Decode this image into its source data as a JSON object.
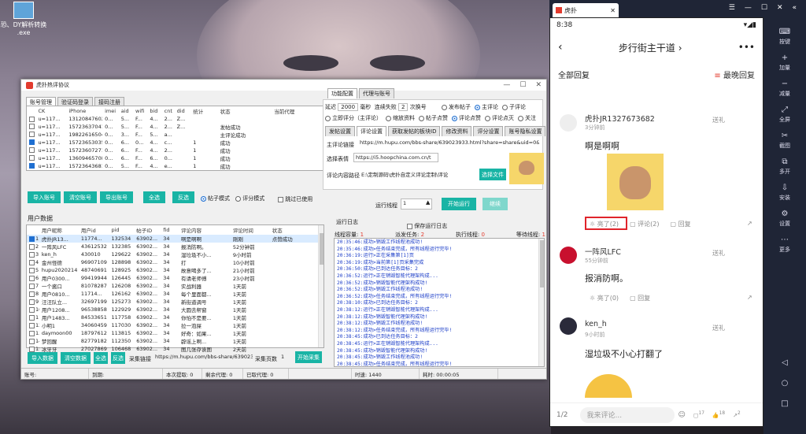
{
  "desktop": {
    "icon_label": "恐、DY解析转换\n.exe"
  },
  "window": {
    "title": "虎扑热评协议"
  },
  "left_tabs": [
    "账号管理",
    "验证码登录",
    "接码注册"
  ],
  "account_headers": [
    "",
    "CK",
    "iPhone",
    "imei",
    "aid",
    "wifi",
    "bid",
    "cnt",
    "did",
    "统计",
    "状态",
    "当前代理"
  ],
  "accounts": [
    {
      "n": "1",
      "ck": "u=117...",
      "phone": "13120847602",
      "imei": "0...",
      "aid": "5...",
      "wifi": "F...",
      "bid": "4...",
      "cnt": "2...",
      "did": "Z...",
      "stat": "",
      "status": "",
      "proxy": "",
      "checked": false
    },
    {
      "n": "2",
      "ck": "u=117...",
      "phone": "15723637041",
      "imei": "0...",
      "aid": "5...",
      "wifi": "F...",
      "bid": "4...",
      "cnt": "2...",
      "did": "Z...",
      "stat": "",
      "status": "发帖成功",
      "proxy": "",
      "checked": false
    },
    {
      "n": "3",
      "ck": "u=117...",
      "phone": "19822616504",
      "imei": "0...",
      "aid": "3...",
      "wifi": "F...",
      "bid": "5...",
      "cnt": "a...",
      "did": "",
      "stat": "",
      "status": "主评论成功",
      "proxy": "",
      "checked": false
    },
    {
      "n": "4",
      "ck": "u=117...",
      "phone": "15723653035",
      "imei": "0...",
      "aid": "6...",
      "wifi": "0...",
      "bid": "4...",
      "cnt": "c...",
      "did": "",
      "stat": "1",
      "status": "成功",
      "proxy": "",
      "checked": true
    },
    {
      "n": "5",
      "ck": "u=117...",
      "phone": "15723607271",
      "imei": "0...",
      "aid": "6...",
      "wifi": "F...",
      "bid": "4...",
      "cnt": "2...",
      "did": "",
      "stat": "1",
      "status": "成功",
      "proxy": "",
      "checked": false
    },
    {
      "n": "6",
      "ck": "u=117...",
      "phone": "13609465708",
      "imei": "0...",
      "aid": "6...",
      "wifi": "F...",
      "bid": "6...",
      "cnt": "0...",
      "did": "",
      "stat": "1",
      "status": "成功",
      "proxy": "",
      "checked": false
    },
    {
      "n": "7",
      "ck": "u=117...",
      "phone": "15723643681",
      "imei": "0...",
      "aid": "5...",
      "wifi": "F...",
      "bid": "4...",
      "cnt": "e...",
      "did": "",
      "stat": "1",
      "status": "成功",
      "proxy": "",
      "checked": true
    }
  ],
  "account_buttons": {
    "import": "导入账号",
    "clear": "清空账号",
    "export": "导出账号",
    "select_all": "全选",
    "invert": "反选"
  },
  "mode": {
    "post": "帖子模式",
    "comment": "评分模式",
    "skip": "跳过已使用"
  },
  "users_label": "用户数据",
  "user_headers": [
    "",
    "用户昵称",
    "用户id",
    "pid",
    "帖子ID",
    "fid",
    "评论内容",
    "评论时间",
    "状态"
  ],
  "users": [
    {
      "n": "1",
      "nick": "虎扑JR13...",
      "uid": "11774...",
      "pid": "132534",
      "tid": "63902...",
      "fid": "34",
      "content": "啊是啊啊",
      "time": "刚刚",
      "status": "点赞成功",
      "checked": true
    },
    {
      "n": "2",
      "nick": "一阵风LFC",
      "uid": "43612532",
      "pid": "132385",
      "tid": "63902...",
      "fid": "34",
      "content": "报消防啊。",
      "time": "52分钟前",
      "status": "",
      "checked": false
    },
    {
      "n": "3",
      "nick": "ken_h",
      "uid": "430010",
      "pid": "129622",
      "tid": "63902...",
      "fid": "34",
      "content": "湿垃圾不小...",
      "time": "9小时前",
      "status": "",
      "checked": false
    },
    {
      "n": "4",
      "nick": "金州怪德",
      "uid": "96907109",
      "pid": "128898",
      "tid": "63902...",
      "fid": "34",
      "content": "打",
      "time": "10小时前",
      "status": "",
      "checked": false
    },
    {
      "n": "5",
      "nick": "hupu2020214",
      "uid": "48740691",
      "pid": "128925",
      "tid": "63902...",
      "fid": "34",
      "content": "故意喝多了...",
      "time": "21小时前",
      "status": "",
      "checked": false
    },
    {
      "n": "6",
      "nick": "用户0300...",
      "uid": "99419944",
      "pid": "126445",
      "tid": "63902...",
      "fid": "34",
      "content": "有请老师傅",
      "time": "23小时前",
      "status": "",
      "checked": false
    },
    {
      "n": "7",
      "nick": "一个酱口",
      "uid": "81078287",
      "pid": "126208",
      "tid": "63902...",
      "fid": "34",
      "content": "实战利器",
      "time": "1天前",
      "status": "",
      "checked": false
    },
    {
      "n": "8",
      "nick": "用户0810...",
      "uid": "11714...",
      "pid": "126162",
      "tid": "63902...",
      "fid": "34",
      "content": "每个里面都...",
      "time": "1天前",
      "status": "",
      "checked": false
    },
    {
      "n": "9",
      "nick": "汪汪队立...",
      "uid": "32697199",
      "pid": "125273",
      "tid": "63902...",
      "fid": "34",
      "content": "新街道调号",
      "time": "1天前",
      "status": "",
      "checked": false
    },
    {
      "n": "10",
      "nick": "用户1208...",
      "uid": "96538858",
      "pid": "122929",
      "tid": "63902...",
      "fid": "34",
      "content": "大圆去帮窗",
      "time": "1天前",
      "status": "",
      "checked": false
    },
    {
      "n": "11",
      "nick": "用户1483...",
      "uid": "84533651",
      "pid": "117758",
      "tid": "63902...",
      "fid": "34",
      "content": "你怕不是要...",
      "time": "1天前",
      "status": "",
      "checked": false
    },
    {
      "n": "12",
      "nick": "小明1",
      "uid": "34060459",
      "pid": "117030",
      "tid": "63902...",
      "fid": "34",
      "content": "拉一泡屎",
      "time": "1天前",
      "status": "",
      "checked": false
    },
    {
      "n": "13",
      "nick": "daymoon00",
      "uid": "18797612",
      "pid": "113815",
      "tid": "63902...",
      "fid": "34",
      "content": "好奇：如果...",
      "time": "1天前",
      "status": "",
      "checked": false
    },
    {
      "n": "14",
      "nick": "梦回醒",
      "uid": "82779182",
      "pid": "112350",
      "tid": "63902...",
      "fid": "34",
      "content": "辟谣上啊...",
      "time": "1天前",
      "status": "",
      "checked": false
    },
    {
      "n": "15",
      "nick": "冰牙牙",
      "uid": "27027869",
      "pid": "106468",
      "tid": "63902...",
      "fid": "34",
      "content": "图几张存诶图",
      "time": "2天前",
      "status": "",
      "checked": false
    }
  ],
  "user_buttons": {
    "import": "导入数据",
    "clear": "清空数据",
    "select_all": "全选",
    "invert": "反选",
    "link_label": "采集链接",
    "link": "https://m.hupu.com/bbs-share/639023",
    "pages_label": "采集页数",
    "pages": "1",
    "start": "开始采集"
  },
  "right_tabs": [
    "功能配置",
    "代理与账号"
  ],
  "config": {
    "delay_label": "延迟",
    "delay": "2000",
    "ms": "毫秒",
    "fail_label": "连续失败",
    "fail": "2",
    "switch": "次换号",
    "r1": [
      "发布帖子",
      "主评论",
      "子评论"
    ],
    "r2": [
      "立即评分（主评论）",
      "缩放资料",
      "帖子点赞",
      "评论点赞",
      "评论点灭",
      "关注"
    ],
    "sub_tabs": [
      "发帖设置",
      "评论设置",
      "获取发帖的板块ID",
      "修改资料",
      "评分设置",
      "账号隐私设置"
    ],
    "link_label": "主评论链接",
    "link": "https://m.hupu.com/bbs-share/639023933.html?share=share&uid=0&ci",
    "emoji_label": "选择表情",
    "emoji": "https://i5.hoopchina.com.cn/t",
    "path_label": "评论内容路径",
    "path": "E:\\定制源码\\虎扑自定义评论定制\\评论",
    "choose": "选择文件"
  },
  "run": {
    "threads_label": "运行线程",
    "threads": "1",
    "start": "开始运行",
    "cont": "继续"
  },
  "log": {
    "title": "运行日志",
    "save": "保存运行日志",
    "thread_count_label": "线程容量:",
    "thread_count": "1",
    "tasks_label": "派发任务:",
    "tasks": "2",
    "exec_label": "执行线程:",
    "exec": "0",
    "wait_label": "等待线程:",
    "wait": "1",
    "lines": [
      "20:35:46:成功>销毁工作线程池成功!",
      "20:35:46:成功>任务结束完成，所有线程运行完毕!",
      "20:36:19:运行>正在采集第[1]页",
      "20:36:19:成功>当前第[1]页采集完成",
      "20:36:50:成功>已到达任务目标：2",
      "20:36:52:运行>正在销毁智能代理架构成...",
      "20:36:52:成功>销毁智能代理架构成功!",
      "20:36:52:成功>销毁工作线程池成功!",
      "20:36:52:成功>任务结束完成，所有线程运行完毕!",
      "20:38:10:成功>已到达任务目标：2",
      "20:38:12:运行>正在销毁智能代理架构成...",
      "20:38:12:成功>销毁智能代理架构成功!",
      "20:38:12:成功>销毁工作线程池成功!",
      "20:38:12:成功>任务结束完成，所有线程运行完毕!",
      "20:38:45:成功>已到达任务目标：2",
      "20:38:45:运行>正在销毁智能代理架构成...",
      "20:38:45:成功>销毁智能代理架构成功!",
      "20:38:45:成功>销毁工作线程池成功!",
      "20:38:45:成功>任务结束完成，所有线程运行完毕!"
    ]
  },
  "statusbar": {
    "account": "账号:",
    "arrived": "到期:",
    "fetched": "本次提取: 0",
    "remaining": "剩余代理: 0",
    "used": "已取代理: 0",
    "time": "时速: 1440",
    "elapsed": "耗时: 00:00:05"
  },
  "emulator": {
    "tab": "虎扑",
    "clock": "8:38",
    "title": "步行街主干道",
    "title_arrow": "›",
    "all_replies": "全部回复",
    "latest": "最晚回复",
    "sidebar": [
      "按键",
      "加量",
      "减量",
      "全屏",
      "截图",
      "多开",
      "安装",
      "设置",
      "更多"
    ],
    "comments": [
      {
        "user": "虎扑JR1327673682",
        "time": "3分钟前",
        "text": "啊是啊啊",
        "gift": "送礼",
        "likes": "亮了(2)",
        "reply": "评论(2)",
        "reply2": "回复"
      },
      {
        "user": "一阵风LFC",
        "time": "55分钟前",
        "text": "报消防啊。",
        "gift": "送礼",
        "likes": "亮了(0)",
        "reply": "回复"
      },
      {
        "user": "ken_h",
        "time": "9小时前",
        "text": "湿垃圾不小心打翻了",
        "gift": "送礼"
      }
    ],
    "bottom": {
      "page": "1/2",
      "placeholder": "我来评论...",
      "c1": "17",
      "c2": "18",
      "c3": "2"
    }
  },
  "colors": {
    "accent": "#19b4a5",
    "red": "#e23b2e",
    "log_blue": "#1a3cc8"
  }
}
